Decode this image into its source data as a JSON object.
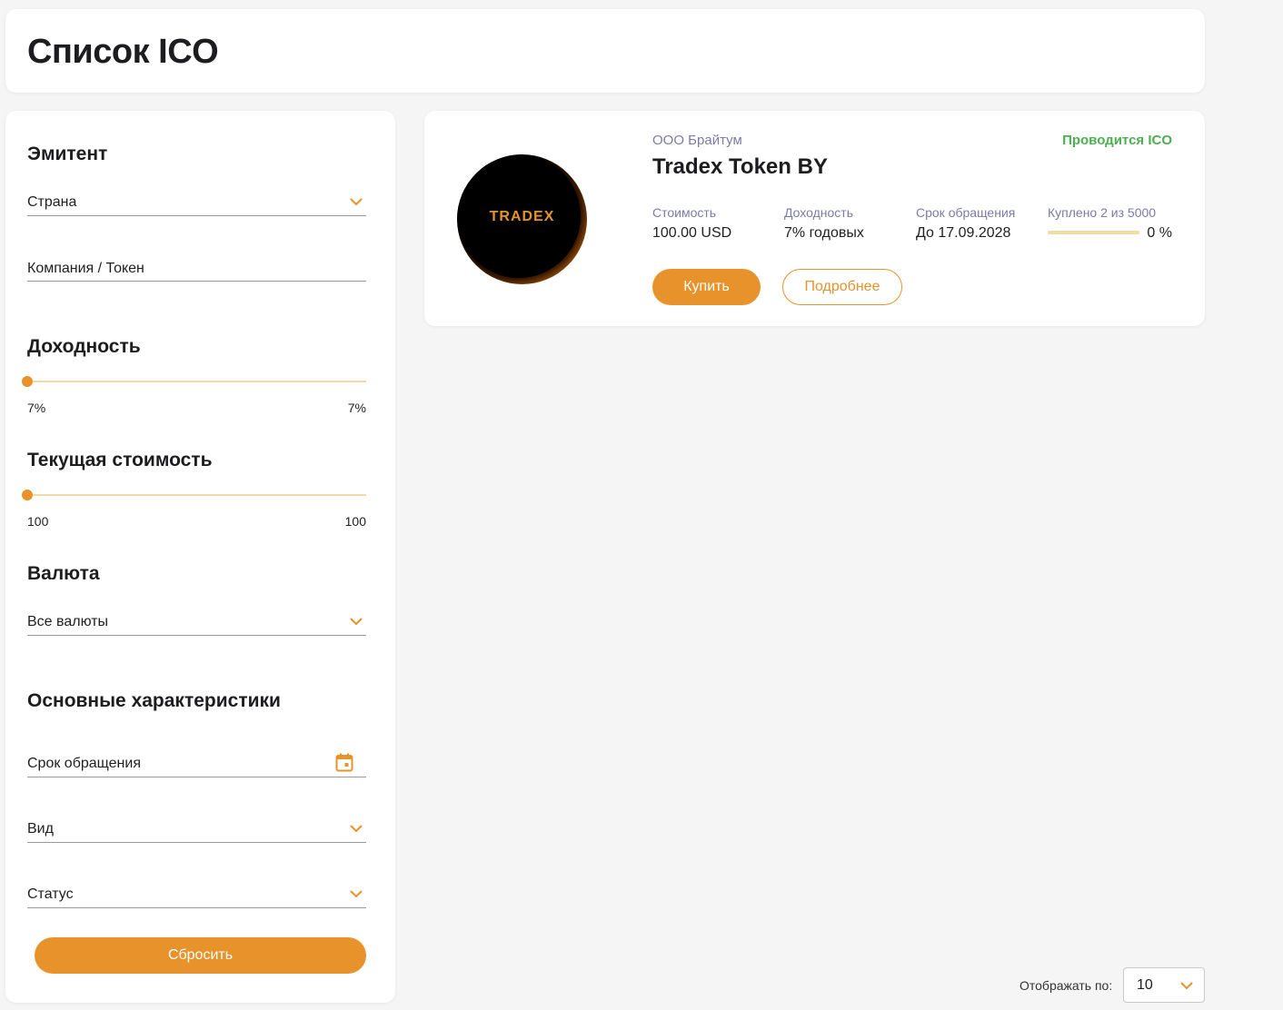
{
  "header": {
    "title": "Список ICO"
  },
  "filters": {
    "issuer": {
      "title": "Эмитент",
      "country": "Страна",
      "company_token": "Компания / Токен"
    },
    "yield": {
      "title": "Доходность",
      "min_label": "7%",
      "max_label": "7%"
    },
    "price": {
      "title": "Текущая стоимость",
      "min_label": "100",
      "max_label": "100"
    },
    "currency": {
      "title": "Валюта",
      "selected": "Все валюты"
    },
    "characteristics": {
      "title": "Основные характеристики",
      "term": "Срок обращения",
      "type": "Вид",
      "status": "Статус"
    },
    "reset_label": "Сбросить"
  },
  "token": {
    "logo_text": "TRADEX",
    "issuer": "ООО Брайтум",
    "name": "Tradex Token BY",
    "status": "Проводится ICO",
    "metrics": [
      {
        "label": "Стоимость",
        "value": "100.00 USD"
      },
      {
        "label": "Доходность",
        "value": "7% годовых"
      },
      {
        "label": "Срок обращения",
        "value": "До 17.09.2028"
      }
    ],
    "progress": {
      "label": "Куплено 2 из 5000",
      "percent_label": "0 %",
      "fraction": 0.0004
    },
    "buy_label": "Купить",
    "more_label": "Подробнее"
  },
  "pagination": {
    "label": "Отображать по:",
    "value": "10"
  },
  "colors": {
    "accent": "#e8922b",
    "accent_light": "#f2dba6",
    "status": "#4caf50",
    "muted": "#7d7ba6"
  }
}
